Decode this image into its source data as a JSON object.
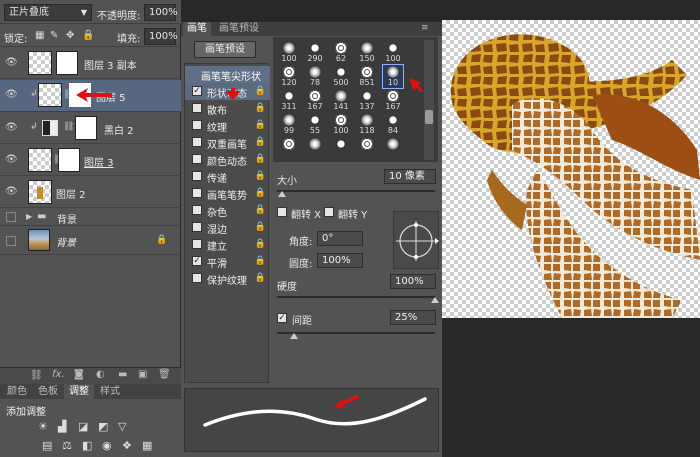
{
  "layers_panel": {
    "blend_mode": "正片叠底",
    "opacity_label": "不透明度:",
    "opacity_value": "100%",
    "lock_label": "锁定:",
    "fill_label": "填充:",
    "fill_value": "100%",
    "layers": [
      {
        "name": "图层 3 副本"
      },
      {
        "name": "图层 5"
      },
      {
        "name": "黑白 2"
      },
      {
        "name": "图层 3"
      },
      {
        "name": "图层 2"
      },
      {
        "name": "背景"
      },
      {
        "name": "背景"
      }
    ],
    "bottom_tabs": [
      "颜色",
      "色板",
      "调整",
      "样式"
    ],
    "adjust_title": "添加调整"
  },
  "brush_panel": {
    "tabs": [
      "画笔",
      "画笔预设"
    ],
    "preset_button": "画笔预设",
    "options": [
      {
        "label": "画笔笔尖形状",
        "checked": null
      },
      {
        "label": "形状动态",
        "checked": true
      },
      {
        "label": "散布",
        "checked": false
      },
      {
        "label": "纹理",
        "checked": false
      },
      {
        "label": "双重画笔",
        "checked": false
      },
      {
        "label": "颜色动态",
        "checked": false
      },
      {
        "label": "传递",
        "checked": false
      },
      {
        "label": "画笔笔势",
        "checked": false
      },
      {
        "label": "杂色",
        "checked": false
      },
      {
        "label": "湿边",
        "checked": false
      },
      {
        "label": "建立",
        "checked": false
      },
      {
        "label": "平滑",
        "checked": true
      },
      {
        "label": "保护纹理",
        "checked": false
      }
    ],
    "brush_sizes": [
      "100",
      "290",
      "62",
      "150",
      "100",
      "120",
      "78",
      "500",
      "851",
      "10",
      "311",
      "167",
      "141",
      "137",
      "167",
      "99",
      "55",
      "100",
      "118",
      "84",
      "",
      "",
      "",
      "",
      ""
    ],
    "size_label": "大小",
    "size_value": "10 像素",
    "flip_x": "翻转 X",
    "flip_y": "翻转 Y",
    "angle_label": "角度:",
    "angle_value": "0°",
    "roundness_label": "圆度:",
    "roundness_value": "100%",
    "hardness_label": "硬度",
    "hardness_value": "100%",
    "spacing_label": "间距",
    "spacing_value": "25%"
  }
}
